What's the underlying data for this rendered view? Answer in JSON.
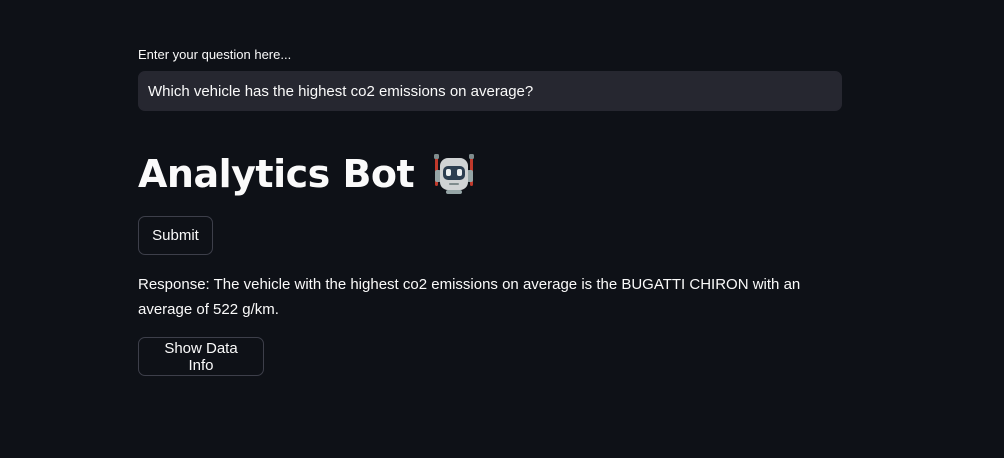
{
  "form": {
    "label": "Enter your question here...",
    "question_value": "Which vehicle has the highest co2 emissions on average?"
  },
  "header": {
    "title": "Analytics Bot",
    "icon": "robot-icon"
  },
  "buttons": {
    "submit_label": "Submit",
    "show_data_info_label": "Show Data Info"
  },
  "response": {
    "text": "Response: The vehicle with the highest co2 emissions on average is the BUGATTI CHIRON with an average of 522 g/km."
  },
  "colors": {
    "background": "#0e1117",
    "input_background": "#262730",
    "text": "#fafafa",
    "button_border": "#3d3f4a"
  }
}
